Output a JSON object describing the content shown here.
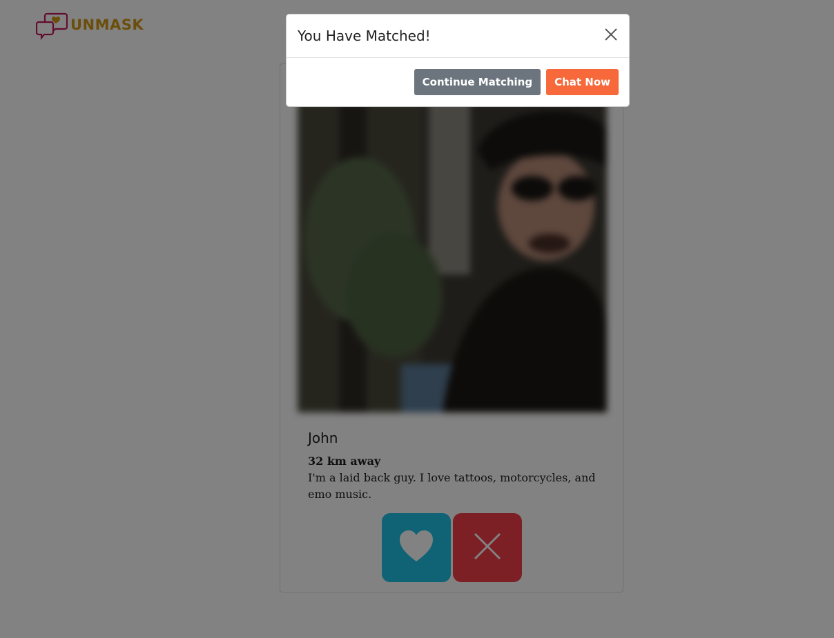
{
  "brand": {
    "name": "UNMASK",
    "logo_icon": "chat-bubbles-heart-icon",
    "colors": {
      "logo_text": "#d39a14",
      "logo_bubbles": "#c2185b"
    }
  },
  "profile": {
    "name": "John",
    "distance": "32 km away",
    "bio": "I'm a laid back guy. I love tattoos, motorcycles, and emo music.",
    "photo_blurred": true
  },
  "actions": {
    "like_icon": "heart-icon",
    "pass_icon": "close-icon",
    "colors": {
      "like": "#1fc3e6",
      "pass": "#f33f4a"
    }
  },
  "modal": {
    "title": "You Have Matched!",
    "close_icon": "close-icon",
    "continue_label": "Continue Matching",
    "chat_label": "Chat Now",
    "colors": {
      "continue": "#6c757d",
      "chat": "#f7693b"
    }
  }
}
